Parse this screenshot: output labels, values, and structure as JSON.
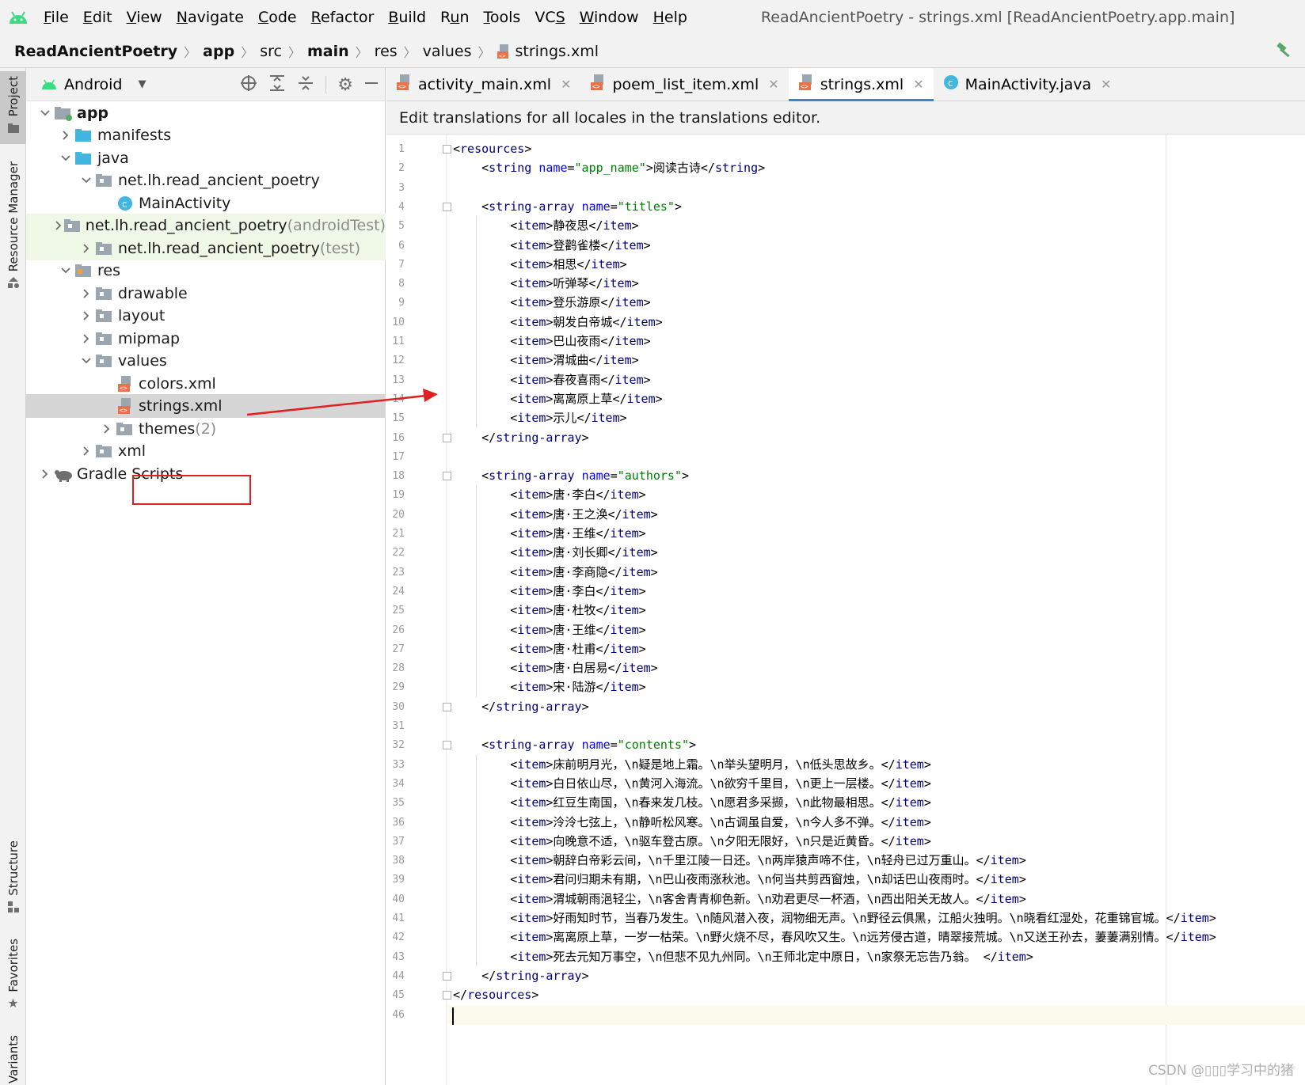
{
  "menubar": {
    "items": [
      {
        "pre": "",
        "mn": "F",
        "post": "ile"
      },
      {
        "pre": "",
        "mn": "E",
        "post": "dit"
      },
      {
        "pre": "",
        "mn": "V",
        "post": "iew"
      },
      {
        "pre": "",
        "mn": "N",
        "post": "avigate"
      },
      {
        "pre": "",
        "mn": "C",
        "post": "ode"
      },
      {
        "pre": "",
        "mn": "R",
        "post": "efactor"
      },
      {
        "pre": "",
        "mn": "B",
        "post": "uild"
      },
      {
        "pre": "R",
        "mn": "u",
        "post": "n"
      },
      {
        "pre": "",
        "mn": "T",
        "post": "ools"
      },
      {
        "pre": "VC",
        "mn": "S",
        "post": ""
      },
      {
        "pre": "",
        "mn": "W",
        "post": "indow"
      },
      {
        "pre": "",
        "mn": "H",
        "post": "elp"
      }
    ],
    "window_title": "ReadAncientPoetry - strings.xml [ReadAncientPoetry.app.main]"
  },
  "breadcrumb": [
    "ReadAncientPoetry",
    "app",
    "src",
    "main",
    "res",
    "values",
    "strings.xml"
  ],
  "left_strip": {
    "project": "Project",
    "resource_manager": "Resource Manager",
    "structure": "Structure",
    "favorites": "Favorites",
    "variants": "Variants"
  },
  "project_panel": {
    "view_selector": "Android",
    "tree": [
      {
        "label": "app",
        "suffix": "",
        "chevron": "down",
        "icon": "module-folder-icon"
      },
      {
        "label": "manifests",
        "suffix": "",
        "chevron": "right",
        "icon": "folder-icon"
      },
      {
        "label": "java",
        "suffix": "",
        "chevron": "down",
        "icon": "folder-icon"
      },
      {
        "label": "net.lh.read_ancient_poetry",
        "suffix": "",
        "chevron": "down",
        "icon": "package-icon"
      },
      {
        "label": "MainActivity",
        "suffix": "",
        "chevron": "",
        "icon": "class-icon"
      },
      {
        "label": "net.lh.read_ancient_poetry",
        "suffix": " (androidTest)",
        "chevron": "right",
        "icon": "package-icon"
      },
      {
        "label": "net.lh.read_ancient_poetry",
        "suffix": " (test)",
        "chevron": "right",
        "icon": "package-icon"
      },
      {
        "label": "res",
        "suffix": "",
        "chevron": "down",
        "icon": "res-folder-icon"
      },
      {
        "label": "drawable",
        "suffix": "",
        "chevron": "right",
        "icon": "package-icon"
      },
      {
        "label": "layout",
        "suffix": "",
        "chevron": "right",
        "icon": "package-icon"
      },
      {
        "label": "mipmap",
        "suffix": "",
        "chevron": "right",
        "icon": "package-icon"
      },
      {
        "label": "values",
        "suffix": "",
        "chevron": "down",
        "icon": "package-icon"
      },
      {
        "label": "colors.xml",
        "suffix": "",
        "chevron": "",
        "icon": "xml-file-icon"
      },
      {
        "label": "strings.xml",
        "suffix": "",
        "chevron": "",
        "icon": "xml-file-icon"
      },
      {
        "label": "themes",
        "suffix": " (2)",
        "chevron": "right",
        "icon": "package-icon"
      },
      {
        "label": "xml",
        "suffix": "",
        "chevron": "right",
        "icon": "package-icon"
      },
      {
        "label": "Gradle Scripts",
        "suffix": "",
        "chevron": "right",
        "icon": "gradle-icon"
      }
    ]
  },
  "editor": {
    "tabs": [
      {
        "label": "activity_main.xml",
        "icon": "xml-file-icon",
        "active": false
      },
      {
        "label": "poem_list_item.xml",
        "icon": "xml-file-icon",
        "active": false
      },
      {
        "label": "strings.xml",
        "icon": "xml-file-icon",
        "active": true
      },
      {
        "label": "MainActivity.java",
        "icon": "class-icon",
        "active": false
      }
    ],
    "banner": "Edit translations for all locales in the translations editor.",
    "code_lines": [
      "<resources>",
      "    <string name=\"app_name\">阅读古诗</string>",
      "",
      "    <string-array name=\"titles\">",
      "        <item>静夜思</item>",
      "        <item>登鹳雀楼</item>",
      "        <item>相思</item>",
      "        <item>听弹琴</item>",
      "        <item>登乐游原</item>",
      "        <item>朝发白帝城</item>",
      "        <item>巴山夜雨</item>",
      "        <item>渭城曲</item>",
      "        <item>春夜喜雨</item>",
      "        <item>离离原上草</item>",
      "        <item>示儿</item>",
      "    </string-array>",
      "",
      "    <string-array name=\"authors\">",
      "        <item>唐·李白</item>",
      "        <item>唐·王之涣</item>",
      "        <item>唐·王维</item>",
      "        <item>唐·刘长卿</item>",
      "        <item>唐·李商隐</item>",
      "        <item>唐·李白</item>",
      "        <item>唐·杜牧</item>",
      "        <item>唐·王维</item>",
      "        <item>唐·杜甫</item>",
      "        <item>唐·白居易</item>",
      "        <item>宋·陆游</item>",
      "    </string-array>",
      "",
      "    <string-array name=\"contents\">",
      "        <item>床前明月光，\\n疑是地上霜。\\n举头望明月，\\n低头思故乡。</item>",
      "        <item>白日依山尽，\\n黄河入海流。\\n欲穷千里目，\\n更上一层楼。</item>",
      "        <item>红豆生南国，\\n春来发几枝。\\n愿君多采撷，\\n此物最相思。</item>",
      "        <item>泠泠七弦上，\\n静听松风寒。\\n古调虽自爱，\\n今人多不弹。</item>",
      "        <item>向晚意不适，\\n驱车登古原。\\n夕阳无限好，\\n只是近黄昏。</item>",
      "        <item>朝辞白帝彩云间，\\n千里江陵一日还。\\n两岸猿声啼不住，\\n轻舟已过万重山。</item>",
      "        <item>君问归期未有期，\\n巴山夜雨涨秋池。\\n何当共剪西窗烛，\\n却话巴山夜雨时。</item>",
      "        <item>渭城朝雨浥轻尘，\\n客舍青青柳色新。\\n劝君更尽一杯酒，\\n西出阳关无故人。</item>",
      "        <item>好雨知时节，当春乃发生。\\n随风潜入夜，润物细无声。\\n野径云俱黑，江船火独明。\\n晓看红湿处，花重锦官城。</item>",
      "        <item>离离原上草，一岁一枯荣。\\n野火烧不尽，春风吹又生。\\n远芳侵古道，晴翠接荒城。\\n又送王孙去，萋萋满别情。</item>",
      "        <item>死去元知万事空，\\n但悲不见九州同。\\n王师北定中原日，\\n家祭无忘告乃翁。 </item>",
      "    </string-array>",
      "</resources>",
      ""
    ]
  },
  "watermark": "CSDN @▯▯▯学习中的猪",
  "colors": {
    "tag": "#000080",
    "attr": "#0000ff",
    "value": "#008000",
    "selection_box": "#e02020"
  }
}
